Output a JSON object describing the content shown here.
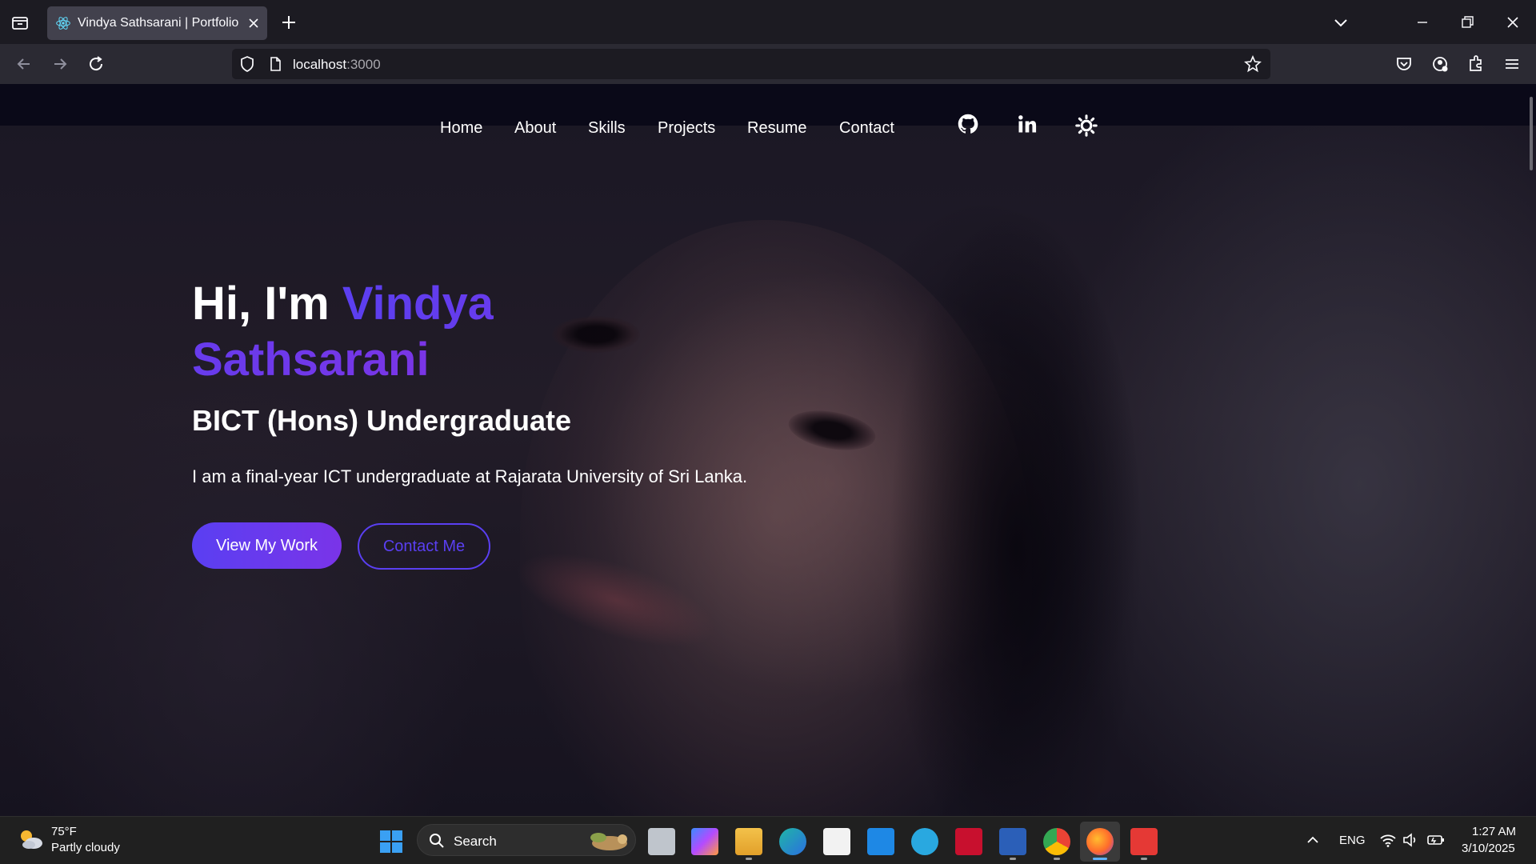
{
  "browser": {
    "tab_title": "Vindya Sathsarani | Portfolio",
    "url_host": "localhost",
    "url_port": ":3000"
  },
  "site": {
    "nav": [
      "Home",
      "About",
      "Skills",
      "Projects",
      "Resume",
      "Contact"
    ],
    "icons": [
      "github-icon",
      "linkedin-icon",
      "theme-toggle-sun-icon"
    ]
  },
  "hero": {
    "greeting": "Hi, I'm",
    "name": "Vindya Sathsarani",
    "subtitle": "BICT (Hons) Undergraduate",
    "description": "I am a final-year ICT undergraduate at Rajarata University of Sri Lanka.",
    "primary_button": "View My Work",
    "secondary_button": "Contact Me"
  },
  "colors": {
    "accent": "#5a3ff2",
    "accent_end": "#7a34e8",
    "nav_bg": "#0a0918"
  },
  "taskbar": {
    "weather_temp": "75°F",
    "weather_desc": "Partly cloudy",
    "search_label": "Search",
    "lang": "ENG",
    "time": "1:27 AM",
    "date": "3/10/2025"
  }
}
